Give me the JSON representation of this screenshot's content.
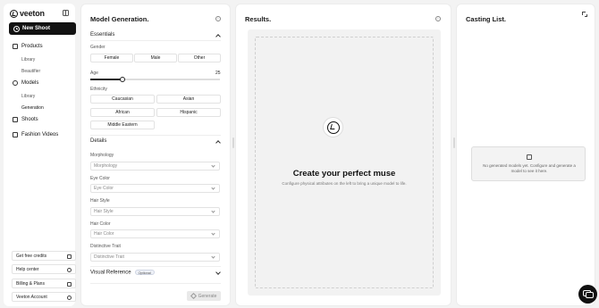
{
  "sidebar": {
    "logo": "veeton",
    "new_shoot": "New Shoot",
    "nav": [
      {
        "label": "Products",
        "icon": "tag-icon"
      },
      {
        "label": "Models",
        "icon": "user-icon"
      },
      {
        "label": "Shoots",
        "icon": "camera-icon"
      },
      {
        "label": "Fashion Videos",
        "icon": "video-icon"
      }
    ],
    "products_sub": [
      "Library",
      "Beautifier"
    ],
    "models_sub": [
      "Library",
      "Generation"
    ],
    "footer": [
      "Get free credits",
      "Help center",
      "Billing & Plans",
      "Veeton Account"
    ]
  },
  "model_panel": {
    "title": "Model Generation.",
    "essentials": "Essentials",
    "gender_label": "Gender",
    "gender_options": [
      "Female",
      "Male",
      "Other"
    ],
    "age_label": "Age",
    "age_value": "25",
    "ethnicity_label": "Ethnicity",
    "ethnicity_options": [
      "Caucasian",
      "Asian",
      "African",
      "Hispanic",
      "Middle Eastern"
    ],
    "details": "Details",
    "fields": [
      {
        "label": "Morphology",
        "placeholder": "Morphology"
      },
      {
        "label": "Eye Color",
        "placeholder": "Eye Color"
      },
      {
        "label": "Hair Style",
        "placeholder": "Hair Style"
      },
      {
        "label": "Hair Color",
        "placeholder": "Hair Color"
      },
      {
        "label": "Distinctive Trait",
        "placeholder": "Distinctive Trait"
      }
    ],
    "visual_reference": "Visual Reference",
    "optional_badge": "Optional",
    "generate": "Generate"
  },
  "results_panel": {
    "title": "Results.",
    "headline": "Create your perfect muse",
    "subtext": "Configure physical attributes on the left to bring a unique model to life."
  },
  "casting_panel": {
    "title": "Casting List.",
    "empty_text": "No generated models yet. Configure and generate a model to see it here."
  }
}
